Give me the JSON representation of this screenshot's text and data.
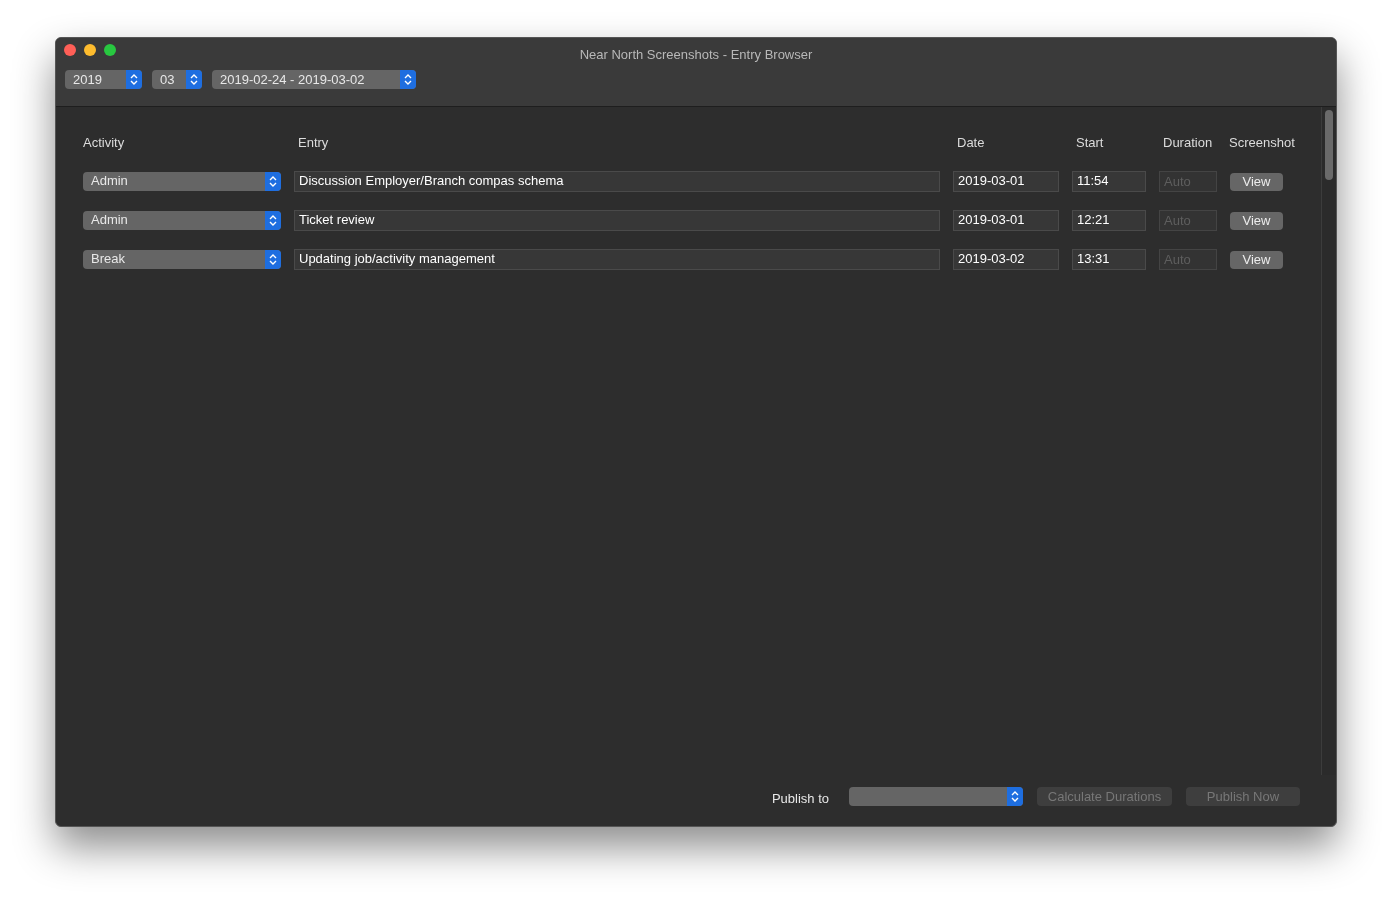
{
  "window": {
    "title": "Near North Screenshots - Entry Browser"
  },
  "toolbar": {
    "year": "2019",
    "month": "03",
    "week": "2019-02-24 - 2019-03-02"
  },
  "table": {
    "columns": [
      "Activity",
      "Entry",
      "Date",
      "Start",
      "Duration",
      "Screenshot"
    ],
    "rows": [
      {
        "activity": "Admin",
        "entry": "Discussion Employer/Branch compas schema",
        "date": "2019-03-01",
        "start": "11:54",
        "duration_placeholder": "Auto",
        "button": "View"
      },
      {
        "activity": "Admin",
        "entry": "Ticket review",
        "date": "2019-03-01",
        "start": "12:21",
        "duration_placeholder": "Auto",
        "button": "View"
      },
      {
        "activity": "Break",
        "entry": "Updating job/activity management",
        "date": "2019-03-02",
        "start": "13:31",
        "duration_placeholder": "Auto",
        "button": "View"
      }
    ]
  },
  "footer": {
    "publish_label": "Publish to",
    "calculate_button": {
      "label": "Calculate Durations",
      "disabled": true
    },
    "publish_button": {
      "label": "Publish Now",
      "disabled": true
    }
  }
}
